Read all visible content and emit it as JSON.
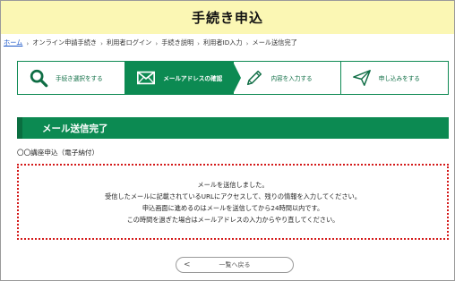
{
  "header": {
    "title": "手続き申込"
  },
  "breadcrumb": {
    "home": "ホーム",
    "items": [
      "オンライン申請手続き",
      "利用者ログイン",
      "手続き説明",
      "利用者ID入力",
      "メール送信完了"
    ],
    "separator": "›"
  },
  "steps": [
    {
      "label": "手続き選択をする",
      "icon": "search-icon",
      "active": false
    },
    {
      "label": "メールアドレスの確認",
      "icon": "mail-icon",
      "active": true
    },
    {
      "label": "内容を入力する",
      "icon": "pencil-icon",
      "active": false
    },
    {
      "label": "申し込みをする",
      "icon": "send-icon",
      "active": false
    }
  ],
  "section": {
    "title": "メール送信完了"
  },
  "course": {
    "name": "〇〇講座申込（電子納付）"
  },
  "notice": {
    "lines": [
      "メールを送信しました。",
      "受信したメールに記載されているURLにアクセスして、残りの情報を入力してください。",
      "申込画面に進めるのはメールを送信してから24時間以内です。",
      "この時間を過ぎた場合はメールアドレスの入力からやり直してください。"
    ]
  },
  "back_button": {
    "label": "一覧へ戻る",
    "chevron": "<"
  },
  "colors": {
    "header_bg": "#fbf7b4",
    "accent_green": "#0c8a52",
    "notice_border": "#d41a1a",
    "link": "#1a56c8"
  }
}
